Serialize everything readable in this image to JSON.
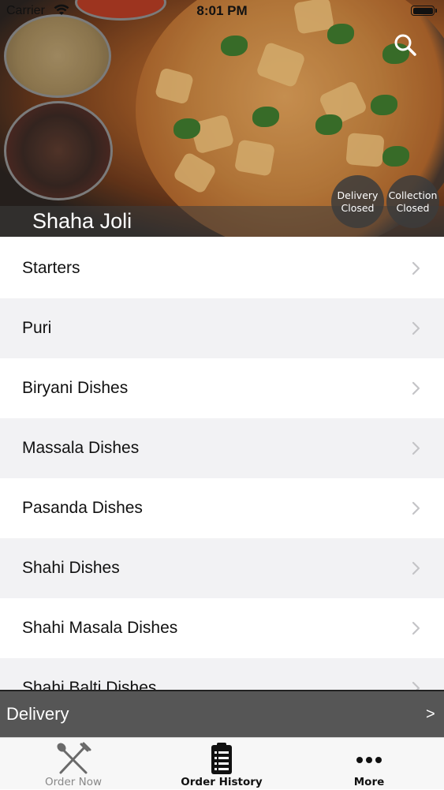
{
  "status_bar": {
    "carrier": "Carrier",
    "time": "8:01 PM"
  },
  "header": {
    "restaurant_name": "Shaha Joli",
    "delivery_status": {
      "line1": "Delivery",
      "line2": "Closed"
    },
    "collection_status": {
      "line1": "Collection",
      "line2": "Closed"
    },
    "search_icon": "search-icon"
  },
  "menu": {
    "categories": [
      {
        "label": "Starters"
      },
      {
        "label": "Puri"
      },
      {
        "label": "Biryani Dishes"
      },
      {
        "label": "Massala Dishes"
      },
      {
        "label": "Pasanda Dishes"
      },
      {
        "label": "Shahi Dishes"
      },
      {
        "label": "Shahi Masala Dishes"
      },
      {
        "label": "Shahi Balti Dishes"
      }
    ]
  },
  "delivery_bar": {
    "label": "Delivery",
    "arrow": ">"
  },
  "tab_bar": {
    "tabs": [
      {
        "label": "Order Now",
        "icon": "fork-knife-icon"
      },
      {
        "label": "Order History",
        "icon": "clipboard-list-icon"
      },
      {
        "label": "More",
        "icon": "more-dots-icon"
      }
    ]
  },
  "colors": {
    "accent_bar": "#565656",
    "row_alt": "#f2f2f4",
    "status_circle": "#3c3c3c"
  }
}
